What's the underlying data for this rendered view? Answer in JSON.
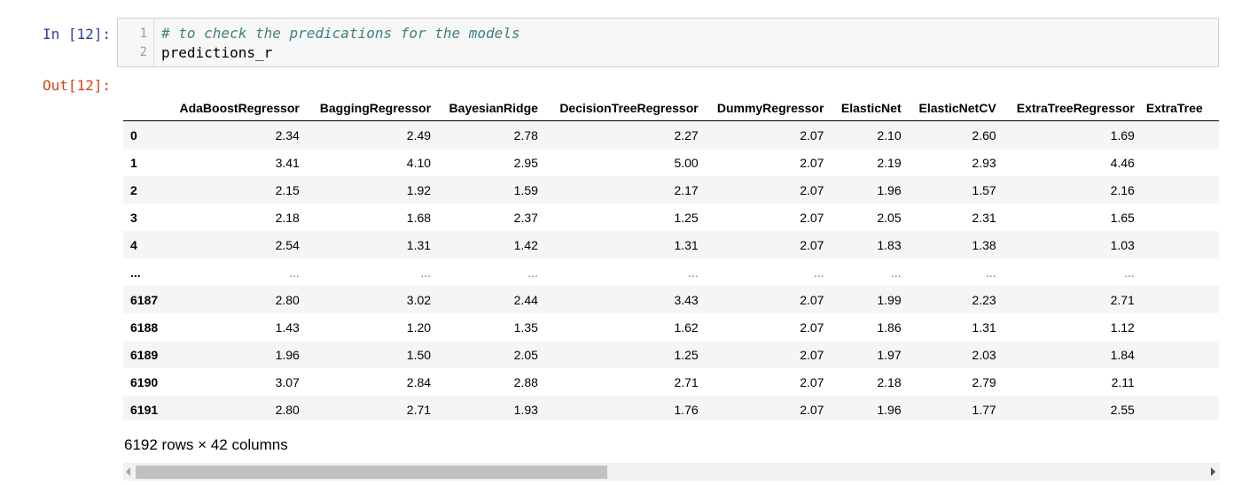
{
  "input_cell": {
    "prompt": "In [12]:",
    "lines": [
      {
        "number": "1",
        "text": "# to check the predications for the models",
        "kind": "comment"
      },
      {
        "number": "2",
        "text": "predictions_r",
        "kind": "code"
      }
    ]
  },
  "output_cell": {
    "prompt": "Out[12]:",
    "table": {
      "columns": [
        "AdaBoostRegressor",
        "BaggingRegressor",
        "BayesianRidge",
        "DecisionTreeRegressor",
        "DummyRegressor",
        "ElasticNet",
        "ElasticNetCV",
        "ExtraTreeRegressor",
        "ExtraTree"
      ],
      "rows": [
        {
          "index": "0",
          "values": [
            "2.34",
            "2.49",
            "2.78",
            "2.27",
            "2.07",
            "2.10",
            "2.60",
            "1.69",
            ""
          ]
        },
        {
          "index": "1",
          "values": [
            "3.41",
            "4.10",
            "2.95",
            "5.00",
            "2.07",
            "2.19",
            "2.93",
            "4.46",
            ""
          ]
        },
        {
          "index": "2",
          "values": [
            "2.15",
            "1.92",
            "1.59",
            "2.17",
            "2.07",
            "1.96",
            "1.57",
            "2.16",
            ""
          ]
        },
        {
          "index": "3",
          "values": [
            "2.18",
            "1.68",
            "2.37",
            "1.25",
            "2.07",
            "2.05",
            "2.31",
            "1.65",
            ""
          ]
        },
        {
          "index": "4",
          "values": [
            "2.54",
            "1.31",
            "1.42",
            "1.31",
            "2.07",
            "1.83",
            "1.38",
            "1.03",
            ""
          ]
        },
        {
          "index": "...",
          "values": [
            "...",
            "...",
            "...",
            "...",
            "...",
            "...",
            "...",
            "...",
            ""
          ]
        },
        {
          "index": "6187",
          "values": [
            "2.80",
            "3.02",
            "2.44",
            "3.43",
            "2.07",
            "1.99",
            "2.23",
            "2.71",
            ""
          ]
        },
        {
          "index": "6188",
          "values": [
            "1.43",
            "1.20",
            "1.35",
            "1.62",
            "2.07",
            "1.86",
            "1.31",
            "1.12",
            ""
          ]
        },
        {
          "index": "6189",
          "values": [
            "1.96",
            "1.50",
            "2.05",
            "1.25",
            "2.07",
            "1.97",
            "2.03",
            "1.84",
            ""
          ]
        },
        {
          "index": "6190",
          "values": [
            "3.07",
            "2.84",
            "2.88",
            "2.71",
            "2.07",
            "2.18",
            "2.79",
            "2.11",
            ""
          ]
        },
        {
          "index": "6191",
          "values": [
            "2.80",
            "2.71",
            "1.93",
            "1.76",
            "2.07",
            "1.96",
            "1.77",
            "2.55",
            ""
          ]
        }
      ]
    },
    "shape_text": "6192 rows × 42 columns",
    "scrollbar": {
      "thumb_fraction": 0.44,
      "scroll_position": 0.0
    }
  },
  "colors": {
    "in_prompt": "#303f9f",
    "out_prompt": "#d84315",
    "comment": "#408080",
    "stripe": "#f5f5f5"
  }
}
